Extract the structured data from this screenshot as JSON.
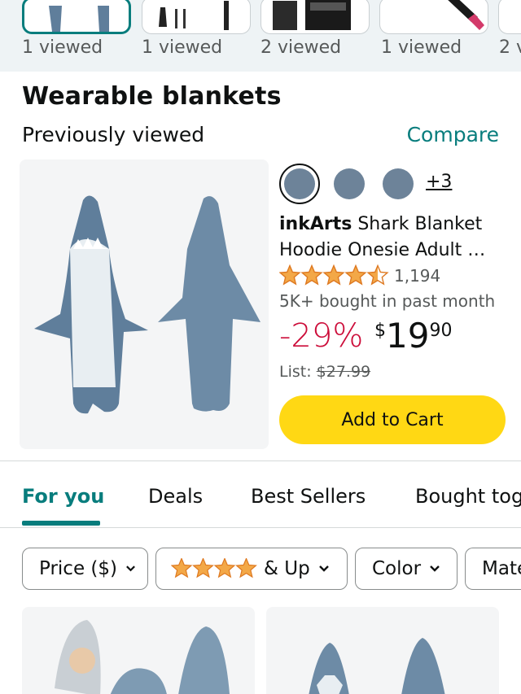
{
  "viewed_strip": {
    "items": [
      {
        "label": "1 viewed",
        "active": true,
        "icon": "shark-blanket-thumbnail"
      },
      {
        "label": "1 viewed",
        "active": false,
        "icon": "tools-thumbnail"
      },
      {
        "label": "2 viewed",
        "active": false,
        "icon": "box-product-thumbnail"
      },
      {
        "label": "1 viewed",
        "active": false,
        "icon": "brush-thumbnail"
      },
      {
        "label": "2 v",
        "active": false,
        "icon": "product-thumbnail"
      }
    ]
  },
  "section": {
    "title": "Wearable blankets",
    "subtitle": "Previously viewed",
    "compare": "Compare"
  },
  "product": {
    "image": "shark-blanket-product-image",
    "swatch_color": "#6d8399",
    "more_swatches": "+3",
    "brand": "inkArts",
    "title_rest": " Shark Blanket",
    "title_line2": "Hoodie Onesie Adult …",
    "rating": 4.5,
    "rating_count": "1,194",
    "bought": "5K+ bought in past month",
    "discount": "-29%",
    "price_symbol": "$",
    "price_whole": "19",
    "price_fraction": "90",
    "list_label": "List:",
    "list_price": "$27.99",
    "cart_button": "Add to Cart"
  },
  "tabs": [
    {
      "label": "For you",
      "active": true
    },
    {
      "label": "Deals",
      "active": false
    },
    {
      "label": "Best Sellers",
      "active": false
    },
    {
      "label": "Bought tog",
      "active": false
    }
  ],
  "filters": {
    "price": "Price ($)",
    "rating_suffix": "& Up",
    "rating_stars": 4,
    "color": "Color",
    "material": "Mate"
  },
  "colors": {
    "accent": "#087d7d",
    "cart_button": "#ffd814",
    "discount": "#cc0c39",
    "star": "#f3a847"
  }
}
